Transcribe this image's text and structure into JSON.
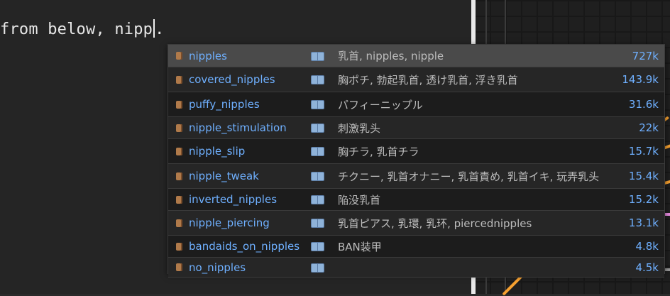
{
  "prompt": {
    "text": "from below, nipp."
  },
  "autocomplete": {
    "items": [
      {
        "tag": "nipples",
        "aliases": "乳首, nipples, nipple",
        "count": "727k"
      },
      {
        "tag": "covered_nipples",
        "aliases": "胸ポチ, 勃起乳首, 透け乳首, 浮き乳首",
        "count": "143.9k"
      },
      {
        "tag": "puffy_nipples",
        "aliases": "パフィーニップル",
        "count": "31.6k"
      },
      {
        "tag": "nipple_stimulation",
        "aliases": "刺激乳头",
        "count": "22k"
      },
      {
        "tag": "nipple_slip",
        "aliases": "胸チラ, 乳首チラ",
        "count": "15.7k"
      },
      {
        "tag": "nipple_tweak",
        "aliases": "チクニー, 乳首オナニー, 乳首責め, 乳首イキ, 玩弄乳头",
        "count": "15.4k"
      },
      {
        "tag": "inverted_nipples",
        "aliases": "陥没乳首",
        "count": "15.2k"
      },
      {
        "tag": "nipple_piercing",
        "aliases": "乳首ピアス, 乳環, 乳环, piercednipples",
        "count": "13.1k"
      },
      {
        "tag": "bandaids_on_nipples",
        "aliases": "BAN装甲",
        "count": "4.8k"
      },
      {
        "tag": "no_nipples",
        "aliases": "",
        "count": "4.5k"
      }
    ]
  },
  "colors": {
    "tag": "#6fb0ff",
    "count": "#6fb0ff",
    "selected_row": "#4a4a4a",
    "link_orange": "#f5a030",
    "link_pink": "#e88be0",
    "link_gray": "#9a9a9a"
  }
}
